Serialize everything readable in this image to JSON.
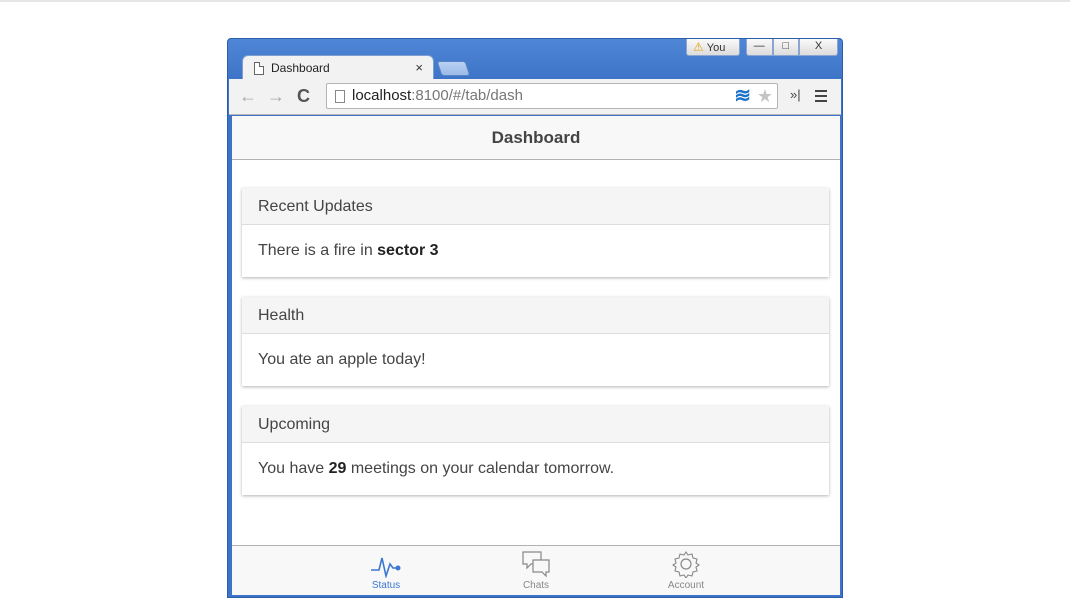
{
  "browser": {
    "profile_label": "You",
    "controls": {
      "minimize": "—",
      "maximize": "□",
      "close": "X"
    },
    "tab": {
      "title": "Dashboard",
      "close": "×"
    },
    "nav": {
      "back": "←",
      "forward": "→",
      "reload": "C"
    },
    "url": {
      "host": "localhost",
      "rest": ":8100/#/tab/dash"
    },
    "icons": [
      "page-icon",
      "extension-icon",
      "bookmark-star-icon",
      "extensions-overflow-icon",
      "menu-icon"
    ]
  },
  "app": {
    "title": "Dashboard",
    "cards": [
      {
        "title": "Recent Updates",
        "text_before": "There is a fire in ",
        "text_bold": "sector 3",
        "text_after": ""
      },
      {
        "title": "Health",
        "text_before": "You ate an apple today!",
        "text_bold": "",
        "text_after": ""
      },
      {
        "title": "Upcoming",
        "text_before": "You have ",
        "text_bold": "29",
        "text_after": " meetings on your calendar tomorrow."
      }
    ],
    "tabs": [
      {
        "label": "Status",
        "icon": "pulse-icon",
        "active": true
      },
      {
        "label": "Chats",
        "icon": "chat-bubbles-icon",
        "active": false
      },
      {
        "label": "Account",
        "icon": "gear-icon",
        "active": false
      }
    ],
    "colors": {
      "active": "#3b78d0",
      "inactive": "#888888"
    }
  }
}
